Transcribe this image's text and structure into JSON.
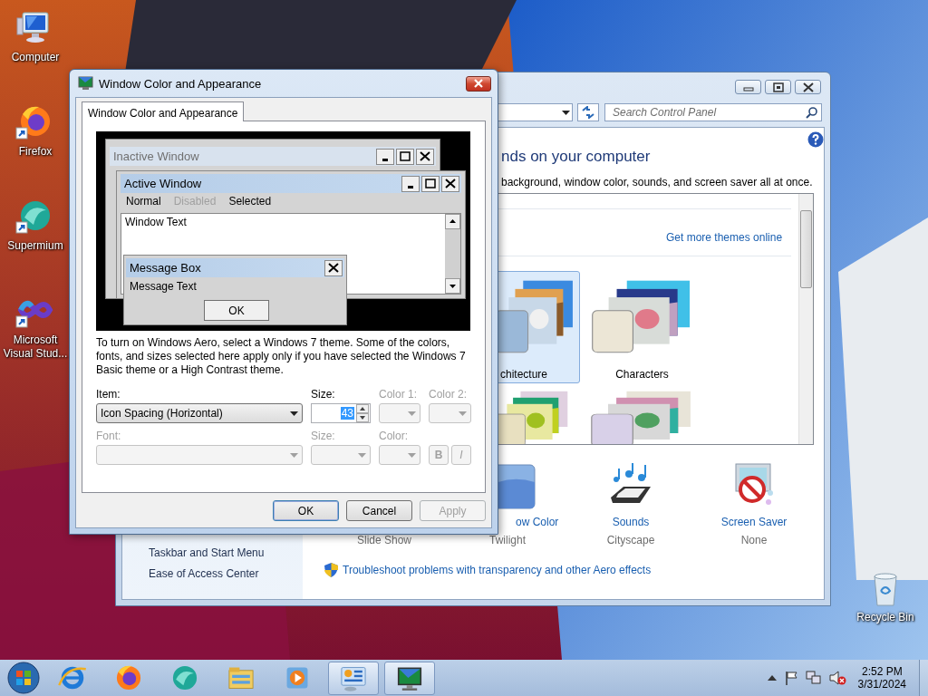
{
  "desktop": {
    "icons": [
      {
        "label": "Computer",
        "kind": "computer",
        "shortcut": false
      },
      {
        "label": "Firefox",
        "kind": "firefox",
        "shortcut": true
      },
      {
        "label": "Supermium",
        "kind": "supermium",
        "shortcut": true
      },
      {
        "label": "Microsoft Visual Stud...",
        "kind": "vs",
        "shortcut": true
      }
    ],
    "recycle_bin": {
      "label": "Recycle Bin"
    }
  },
  "control_panel": {
    "search": {
      "placeholder": "Search Control Panel"
    },
    "heading": "nds on your computer",
    "description": "background, window color, sounds, and screen saver all at once.",
    "themes_link": "Get more themes online",
    "themes": [
      {
        "label": "chitecture",
        "selected": true
      },
      {
        "label": "Characters",
        "selected": false
      }
    ],
    "settings": [
      {
        "kind": "background",
        "value": "Slide Show"
      },
      {
        "kind": "color",
        "label": "ow Color",
        "value": "Twilight"
      },
      {
        "kind": "sounds",
        "label": "Sounds",
        "value": "Cityscape"
      },
      {
        "kind": "screensaver",
        "label": "Screen Saver",
        "value": "None"
      }
    ],
    "sidebar": [
      "Taskbar and Start Menu",
      "Ease of Access Center"
    ],
    "troubleshoot_link": "Troubleshoot problems with transparency and other Aero effects"
  },
  "dialog": {
    "title": "Window Color and Appearance",
    "tab": {
      "label": "Window Color and Appearance",
      "selected": true
    },
    "preview": {
      "inactive_title": "Inactive Window",
      "active_title": "Active Window",
      "menu": [
        {
          "label": "Normal",
          "disabled": false
        },
        {
          "label": "Disabled",
          "disabled": true
        },
        {
          "label": "Selected",
          "disabled": false
        }
      ],
      "window_text": "Window Text",
      "message_box": {
        "title": "Message Box",
        "text": "Message Text",
        "button": "OK"
      }
    },
    "note": "To turn on Windows Aero, select a Windows 7 theme.  Some of the colors, fonts, and sizes selected here apply only if you have selected the Windows 7 Basic theme or a High Contrast theme.",
    "fields": [
      {
        "kind": "dropdown",
        "label": "Item:",
        "value": "Icon Spacing (Horizontal)",
        "disabled": false
      },
      {
        "kind": "spinner",
        "label": "Size:",
        "value": "43",
        "value_selected": true,
        "disabled": false
      },
      {
        "kind": "dropdown",
        "label": "Color 1:",
        "disabled": true
      },
      {
        "kind": "dropdown",
        "label": "Color 2:",
        "disabled": true
      },
      {
        "kind": "dropdown",
        "label": "Font:",
        "disabled": true
      },
      {
        "kind": "dropdown",
        "label": "Size:",
        "disabled": true
      },
      {
        "kind": "dropdown",
        "label": "Color:",
        "disabled": true
      },
      {
        "kind": "style",
        "bold": "B",
        "italic": "I",
        "disabled": true
      }
    ],
    "buttons": [
      {
        "label": "OK",
        "kind": "default",
        "disabled": false
      },
      {
        "label": "Cancel",
        "kind": "normal",
        "disabled": false
      },
      {
        "label": "Apply",
        "kind": "normal",
        "disabled": true
      }
    ]
  },
  "taskbar": {
    "apps": [
      {
        "kind": "ie",
        "selected": false
      },
      {
        "kind": "firefox",
        "selected": false
      },
      {
        "kind": "supermium",
        "selected": false
      },
      {
        "kind": "explorer",
        "selected": false
      },
      {
        "kind": "media",
        "selected": false
      },
      {
        "kind": "controlpanel",
        "selected": true
      },
      {
        "kind": "display",
        "selected": true
      }
    ],
    "time": "2:52 PM",
    "date": "3/31/2024"
  }
}
